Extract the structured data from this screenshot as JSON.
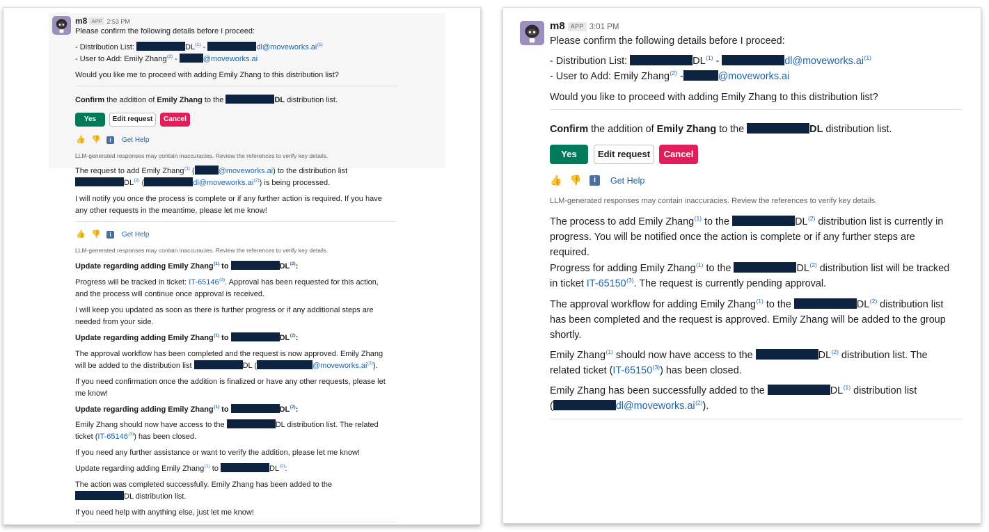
{
  "left": {
    "bot_name": "m8",
    "app_badge": "APP",
    "time": "2:53 PM",
    "intro": "Please confirm the following details before I proceed:",
    "dist_label": "- Distribution List:",
    "dl": "DL",
    "sep": " - ",
    "dl_email": "dl@moveworks.ai",
    "user_label": "- User to Add: Emily Zhang",
    "user_email": "@moveworks.ai",
    "question": "Would you like me to proceed with adding Emily Zhang to this distribution list?",
    "confirm_word": "Confirm",
    "confirm_mid1": " the addition of ",
    "confirm_name": "Emily Zhang",
    "confirm_mid2": " to the ",
    "confirm_dl": "DL",
    "confirm_end": " distribution list.",
    "buttons": {
      "yes": "Yes",
      "edit": "Edit request",
      "cancel": "Cancel"
    },
    "get_help": "Get Help",
    "disclaimer": "LLM-generated responses may contain inaccuracies. Review the references to verify key details.",
    "m1_a": "The request to add Emily Zhang",
    "m1_b": " (",
    "m1_c": "@moveworks.ai",
    "m1_d": ") to the distribution list",
    "m1_e": "DL",
    "m1_f": " (",
    "m1_g": "dl@moveworks.ai",
    "m1_h": ") is being processed.",
    "m2_l1": "I will notify you once the process is complete or if any further action is required. If you have",
    "m2_l2": "any other requests in the meantime, please let me know!",
    "upd_a": "Update regarding adding Emily Zhang",
    "upd_to": " to ",
    "upd_dl": "DL",
    "upd_colon": ":",
    "p1_a": "Progress will be tracked in ticket: ",
    "p1_ticket": "IT-65146",
    "p1_b": ". Approval has been requested for this action,",
    "p1_l2": "and the process will continue once approval is received.",
    "p2_l1": "I will keep you updated as soon as there is further progress or if any additional steps are",
    "p2_l2": "needed from your side.",
    "p3_l1": "The approval workflow has been completed and the request is now approved. Emily Zhang",
    "p3_l2a": "will be added to the distribution list ",
    "p3_l2b": "DL (",
    "p3_l2c": "@moveworks.ai",
    "p3_l2d": ").",
    "p4_l1": "If you need confirmation once the addition is finalized or have any other requests, please let",
    "p4_l2": "me know!",
    "p5_a": "Emily Zhang should now have access to the ",
    "p5_b": "DL distribution list. The related",
    "p5_l2a": "ticket (",
    "p5_ticket": "IT-65146",
    "p5_l2b": ") has been closed.",
    "p6": "If you need any further assistance or want to verify the addition, please let me know!",
    "p7_l1": "The action was completed successfully. Emily Zhang has been added to the",
    "p7_l2": "DL distribution list.",
    "p8": "If you need help with anything else, just let me know!"
  },
  "right": {
    "bot_name": "m8",
    "app_badge": "APP",
    "time": "3:01 PM",
    "intro": "Please confirm the following details before I proceed:",
    "dist_label": "- Distribution List:",
    "dl": "DL",
    "sep": " - ",
    "dl_email": "dl@moveworks.ai",
    "user_label": "- User to Add: Emily Zhang",
    "user_email": "@moveworks.ai",
    "question": "Would you like to proceed with adding Emily Zhang to this distribution list?",
    "confirm_word": "Confirm",
    "confirm_mid1": " the addition of ",
    "confirm_name": "Emily Zhang",
    "confirm_mid2": " to the ",
    "confirm_dl": "DL",
    "confirm_end": " distribution list.",
    "buttons": {
      "yes": "Yes",
      "edit": "Edit request",
      "cancel": "Cancel"
    },
    "get_help": "Get Help",
    "disclaimer": "LLM-generated responses may contain inaccuracies. Review the references to verify key details.",
    "r1_a": "The process to add Emily Zhang",
    "r1_b": " to the ",
    "r1_c": "DL",
    "r1_d": " distribution list is currently in",
    "r1_l2": "progress. You will be notified once the action is complete or if any further steps are",
    "r1_l3": "required.",
    "r2_a": "Progress for adding Emily Zhang",
    "r2_b": " to the ",
    "r2_c": "DL",
    "r2_d": " distribution list will be tracked",
    "r2_l2a": "in ticket ",
    "r2_ticket": "IT-65150",
    "r2_l2b": ". The request is currently pending approval.",
    "r3_a": "The approval workflow for adding Emily Zhang",
    "r3_b": " to the ",
    "r3_c": "DL",
    "r3_d": " distribution list",
    "r3_l2": "has been completed and the request is approved. Emily Zhang will be added to the group",
    "r3_l3": "shortly.",
    "r4_a": "Emily Zhang",
    "r4_b": " should now have access to the ",
    "r4_c": "DL",
    "r4_d": " distribution list. The",
    "r4_l2a": "related ticket (",
    "r4_ticket": "IT-65150",
    "r4_l2b": ") has been closed.",
    "r5_a": "Emily Zhang has been successfully added to the ",
    "r5_b": "DL",
    "r5_c": " distribution list",
    "r5_l2a": "(",
    "r5_email": "dl@moveworks.ai",
    "r5_l2b": ")."
  },
  "refs": {
    "r1": "(1)",
    "r2": "(2)",
    "r3": "(3)"
  },
  "icons": [
    "robot-avatar-icon",
    "thumbs-up-icon",
    "thumbs-down-icon",
    "info-icon"
  ],
  "colors": {
    "accent_link": "#1d64ab",
    "yes": "#007a5a",
    "cancel": "#e01e5a",
    "redaction": "#0e2340"
  }
}
